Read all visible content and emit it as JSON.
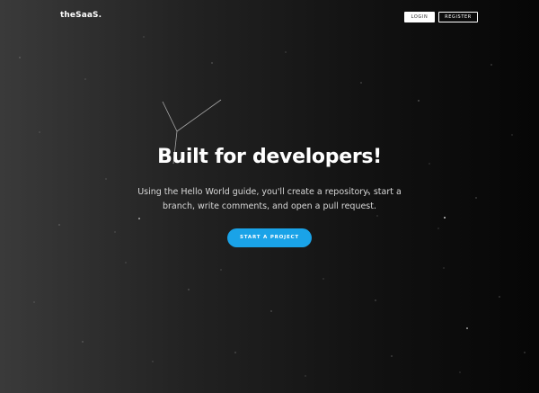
{
  "brand": {
    "logo_text": "theSaaS."
  },
  "nav": {
    "login_label": "LOGIN",
    "register_label": "REGISTER"
  },
  "hero": {
    "headline": "Built for developers!",
    "subtitle": "Using the Hello World guide, you'll create a repository, start a branch, write comments, and open a pull request.",
    "cta_label": "START A PROJECT"
  },
  "colors": {
    "accent": "#1aa3e8",
    "background_dark": "#060606",
    "background_light": "#3a3a3a",
    "text": "#ffffff"
  }
}
